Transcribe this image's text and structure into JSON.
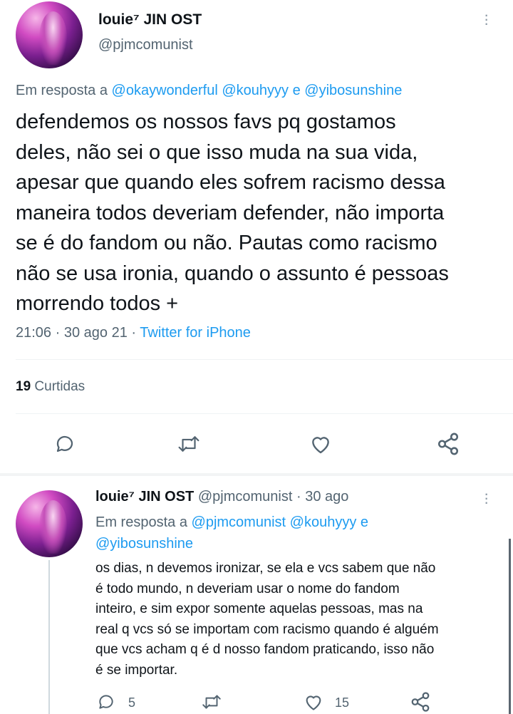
{
  "main_tweet": {
    "display_name": "louie⁷ JIN OST",
    "handle": "@pjmcomunist",
    "reply_prefix": "Em resposta a",
    "reply_to": [
      "@okaywonderful",
      "@kouhyyy",
      "e",
      "@yibosunshine"
    ],
    "text_lines": [
      "defendemos os nossos favs pq gostamos",
      "deles, não sei o que isso muda na sua vida,",
      "apesar que quando eles sofrem racismo dessa",
      "maneira todos deveriam defender, não importa",
      "se é do fandom ou não. Pautas como racismo",
      "não se usa ironia, quando o assunto é pessoas",
      "morrendo todos +"
    ],
    "time": "21:06",
    "date": "30 ago 21",
    "source": "Twitter for iPhone",
    "likes_count": "19",
    "likes_label": "Curtidas",
    "icons": [
      "reply-icon",
      "retweet-icon",
      "like-icon",
      "share-icon"
    ]
  },
  "reply_tweet": {
    "display_name": "louie⁷ JIN OST",
    "handle": "@pjmcomunist",
    "sep": "·",
    "date": "30 ago",
    "reply_prefix": "Em resposta a",
    "reply_to": [
      "@pjmcomunist",
      "@kouhyyy",
      "e",
      "@yibosunshine"
    ],
    "text_lines": [
      "os dias, n devemos ironizar, se ela e vcs sabem que não",
      "é todo mundo, n deveriam usar o nome do fandom",
      "inteiro, e sim expor somente aquelas pessoas, mas na",
      "real q vcs só se importam com racismo quando é alguém",
      "que vcs acham q é d nosso fandom praticando, isso não",
      "é se importar."
    ],
    "reply_count": "5",
    "like_count": "15",
    "colors": {
      "link": "#1d9bf0",
      "muted": "#536471",
      "text": "#0f1419"
    }
  }
}
